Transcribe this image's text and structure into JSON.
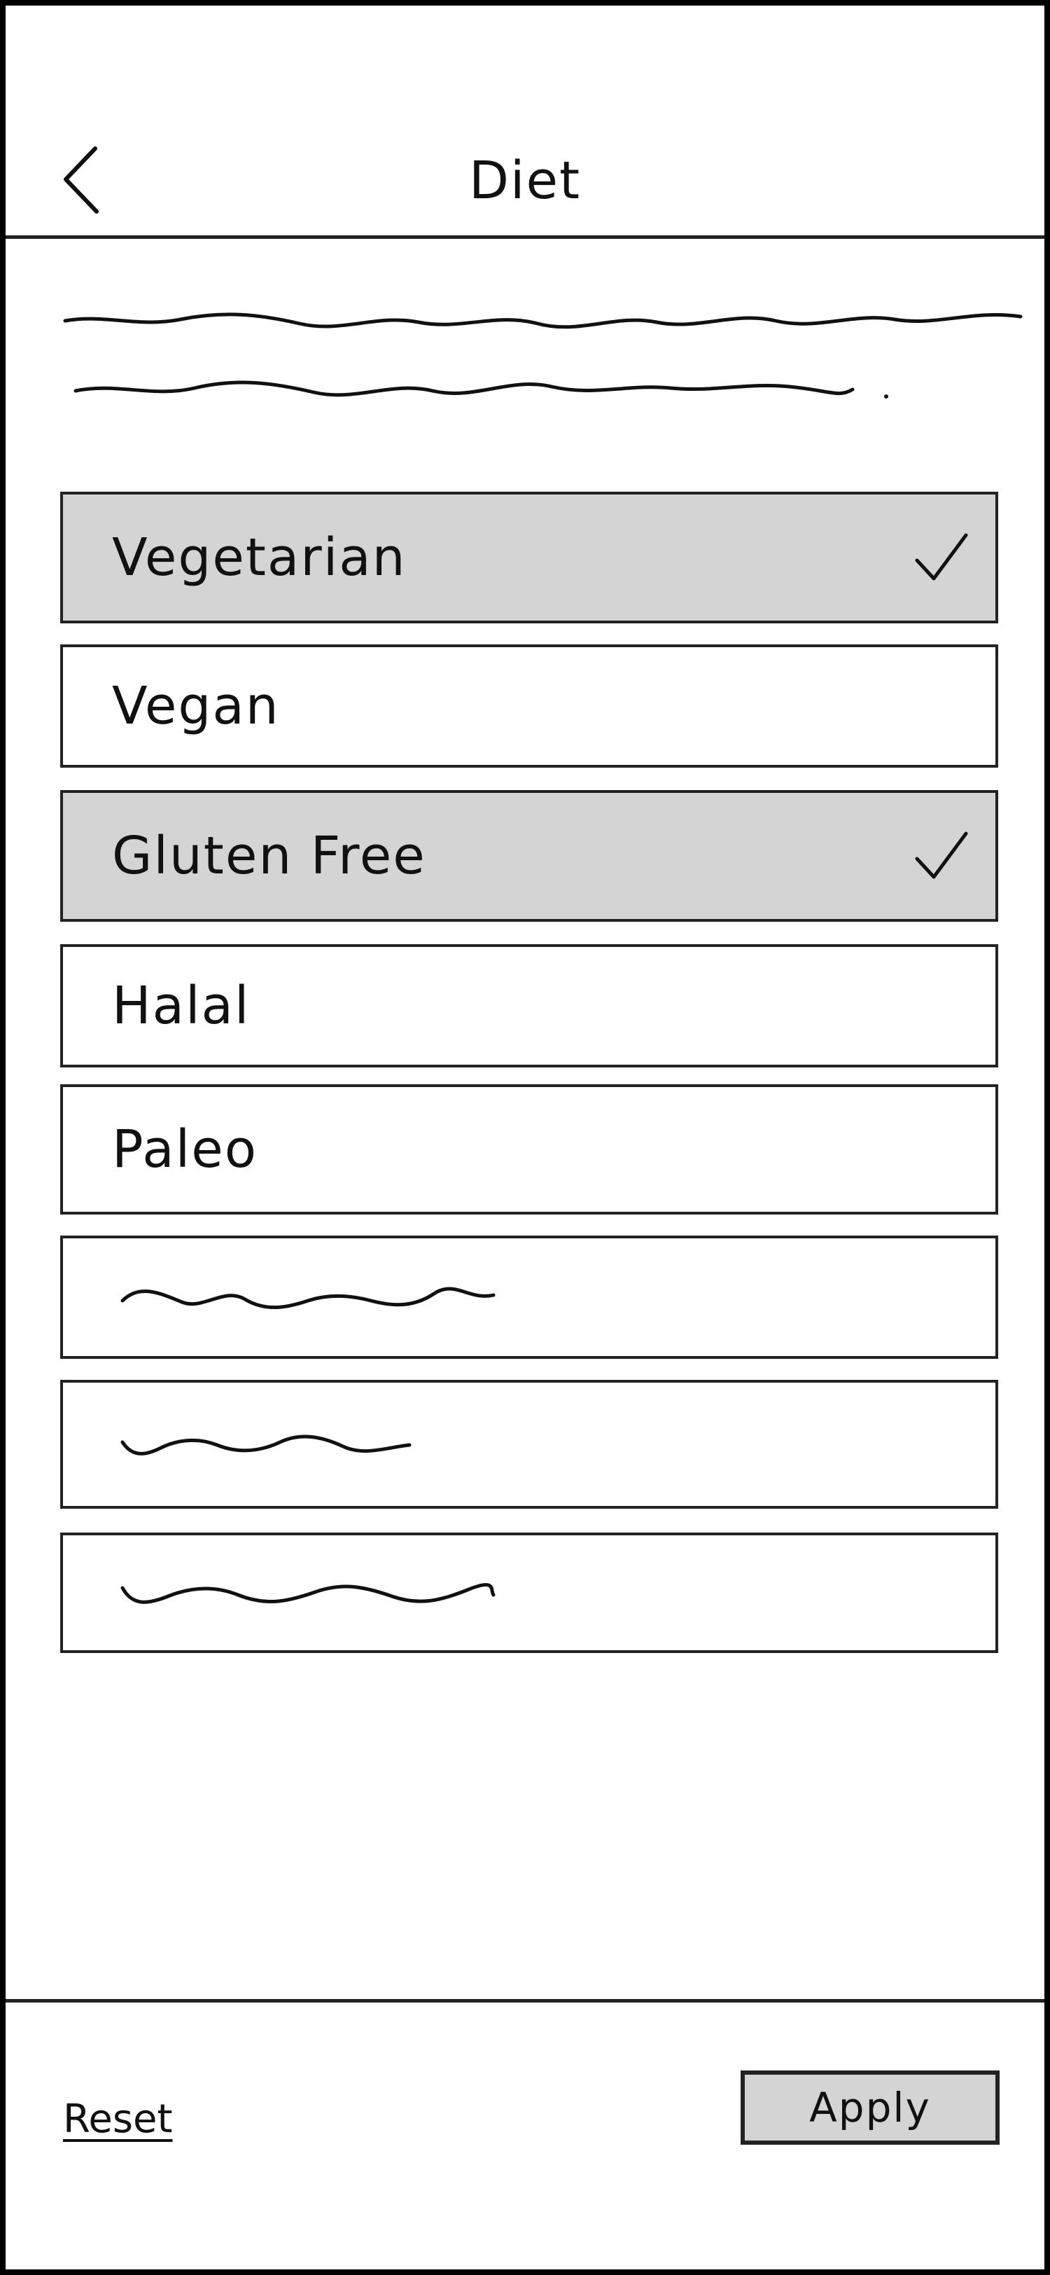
{
  "header": {
    "title": "Diet",
    "back_icon": "chevron-left-icon"
  },
  "options": [
    {
      "label": "Vegetarian",
      "selected": true
    },
    {
      "label": "Vegan",
      "selected": false
    },
    {
      "label": "Gluten Free",
      "selected": true
    },
    {
      "label": "Halal",
      "selected": false
    },
    {
      "label": "Paleo",
      "selected": false
    }
  ],
  "footer": {
    "reset_label": "Reset",
    "apply_label": "Apply"
  },
  "colors": {
    "selected_fill": "#d4d4d4",
    "stroke": "#222222",
    "background": "#ffffff"
  }
}
